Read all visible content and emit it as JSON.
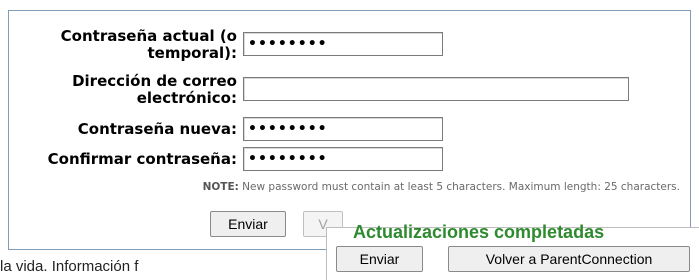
{
  "form": {
    "current_password": {
      "label_line1": "Contraseña actual (o",
      "label_line2": "temporal):",
      "value": "••••••••"
    },
    "email": {
      "label_line1": "Dirección de correo",
      "label_line2": "electrónico:",
      "value": ""
    },
    "new_password": {
      "label": "Contraseña nueva:",
      "value": "••••••••"
    },
    "confirm_password": {
      "label": "Confirmar contraseña:",
      "value": "••••••••"
    },
    "note_prefix": "NOTE:",
    "note_text": " New password must contain at least 5 characters. Maximum length: 25 characters.",
    "submit_label": "Enviar",
    "back_label_partial": "V"
  },
  "overlay": {
    "title": "Actualizaciones completadas",
    "submit_label": "Enviar",
    "back_label": "Volver a ParentConnection"
  },
  "background_text": "la vida. Información f"
}
